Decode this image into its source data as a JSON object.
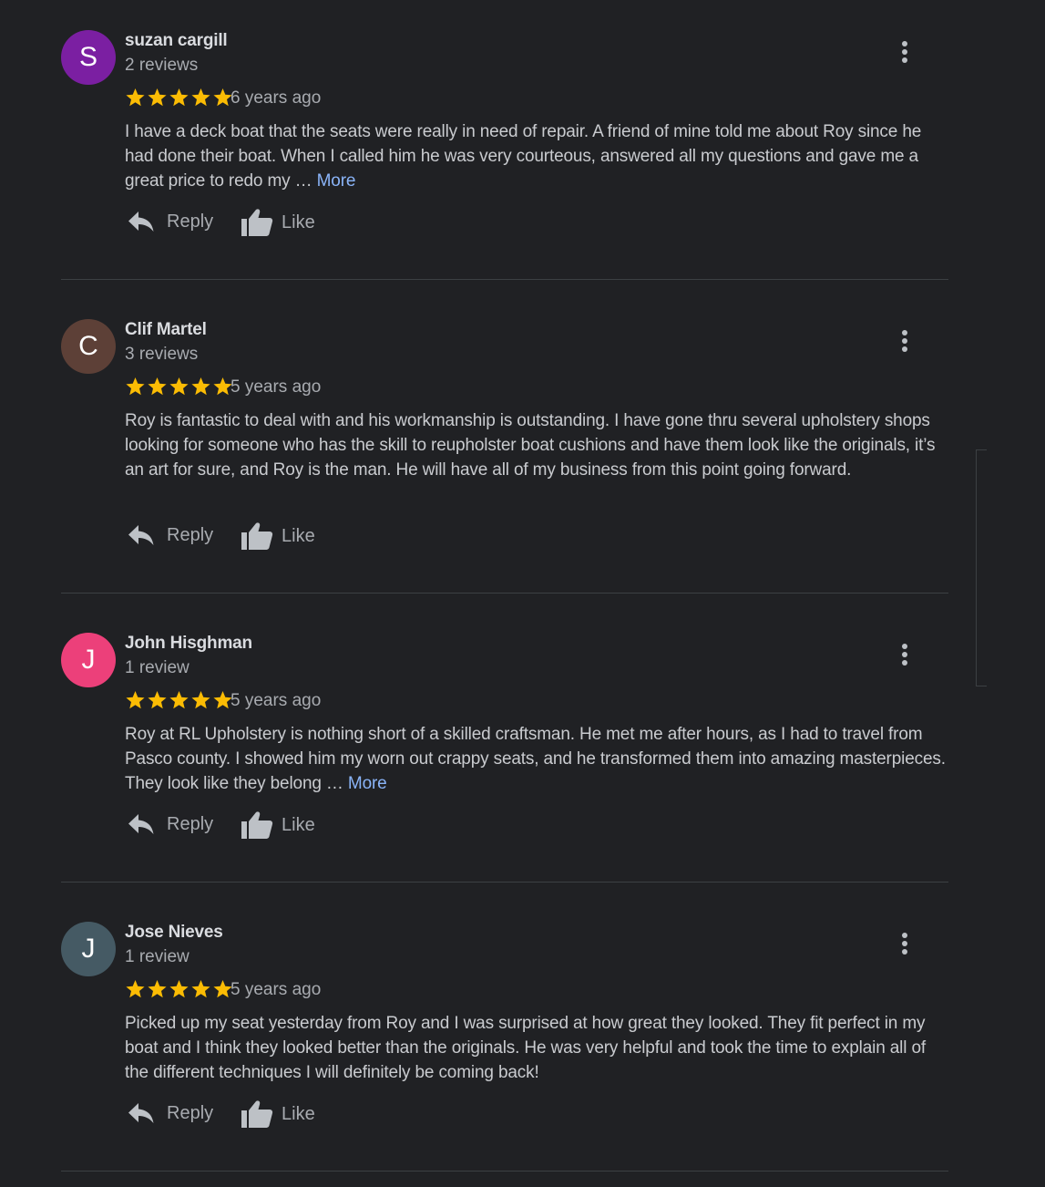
{
  "actions": {
    "reply_label": "Reply",
    "like_label": "Like"
  },
  "reviews": [
    {
      "initial": "S",
      "avatar_color": "#7b1fa2",
      "name": "suzan cargill",
      "count": "2 reviews",
      "rating": 5,
      "time": "6 years ago",
      "text": "I have a deck boat that the seats were really in need of repair. A friend of mine told me about Roy since he had done their boat. When I called him he was very courteous, answered all my questions and gave me a great price to redo my … ",
      "more": "More"
    },
    {
      "initial": "C",
      "avatar_color": "#5d4037",
      "name": "Clif Martel",
      "count": "3 reviews",
      "rating": 5,
      "time": "5 years ago",
      "text": "Roy is fantastic to deal with and his workmanship is outstanding.  I have gone thru several upholstery shops looking for someone who has the skill to reupholster boat cushions and have them look like the originals, it’s an art for sure, and Roy is the man.  He will have all of my business from this point going forward.",
      "more": ""
    },
    {
      "initial": "J",
      "avatar_color": "#ec407a",
      "name": "John Hisghman",
      "count": "1 review",
      "rating": 5,
      "time": "5 years ago",
      "text": "Roy at RL Upholstery is nothing short of a skilled craftsman. He met me after hours, as I had to travel from Pasco county. I showed him my worn out crappy seats, and he transformed them into amazing masterpieces. They look like they belong … ",
      "more": "More"
    },
    {
      "initial": "J",
      "avatar_color": "#455a64",
      "name": "Jose Nieves",
      "count": "1 review",
      "rating": 5,
      "time": "5 years ago",
      "text": "Picked up my seat yesterday from Roy and I was surprised at how great they looked. They fit perfect in my boat and I think they looked better than the originals. He was very helpful and took the time to explain all of the different techniques I will definitely be coming back!",
      "more": ""
    }
  ],
  "colors": {
    "background": "#202124",
    "star": "#fbbc04",
    "link": "#8ab4f8"
  }
}
